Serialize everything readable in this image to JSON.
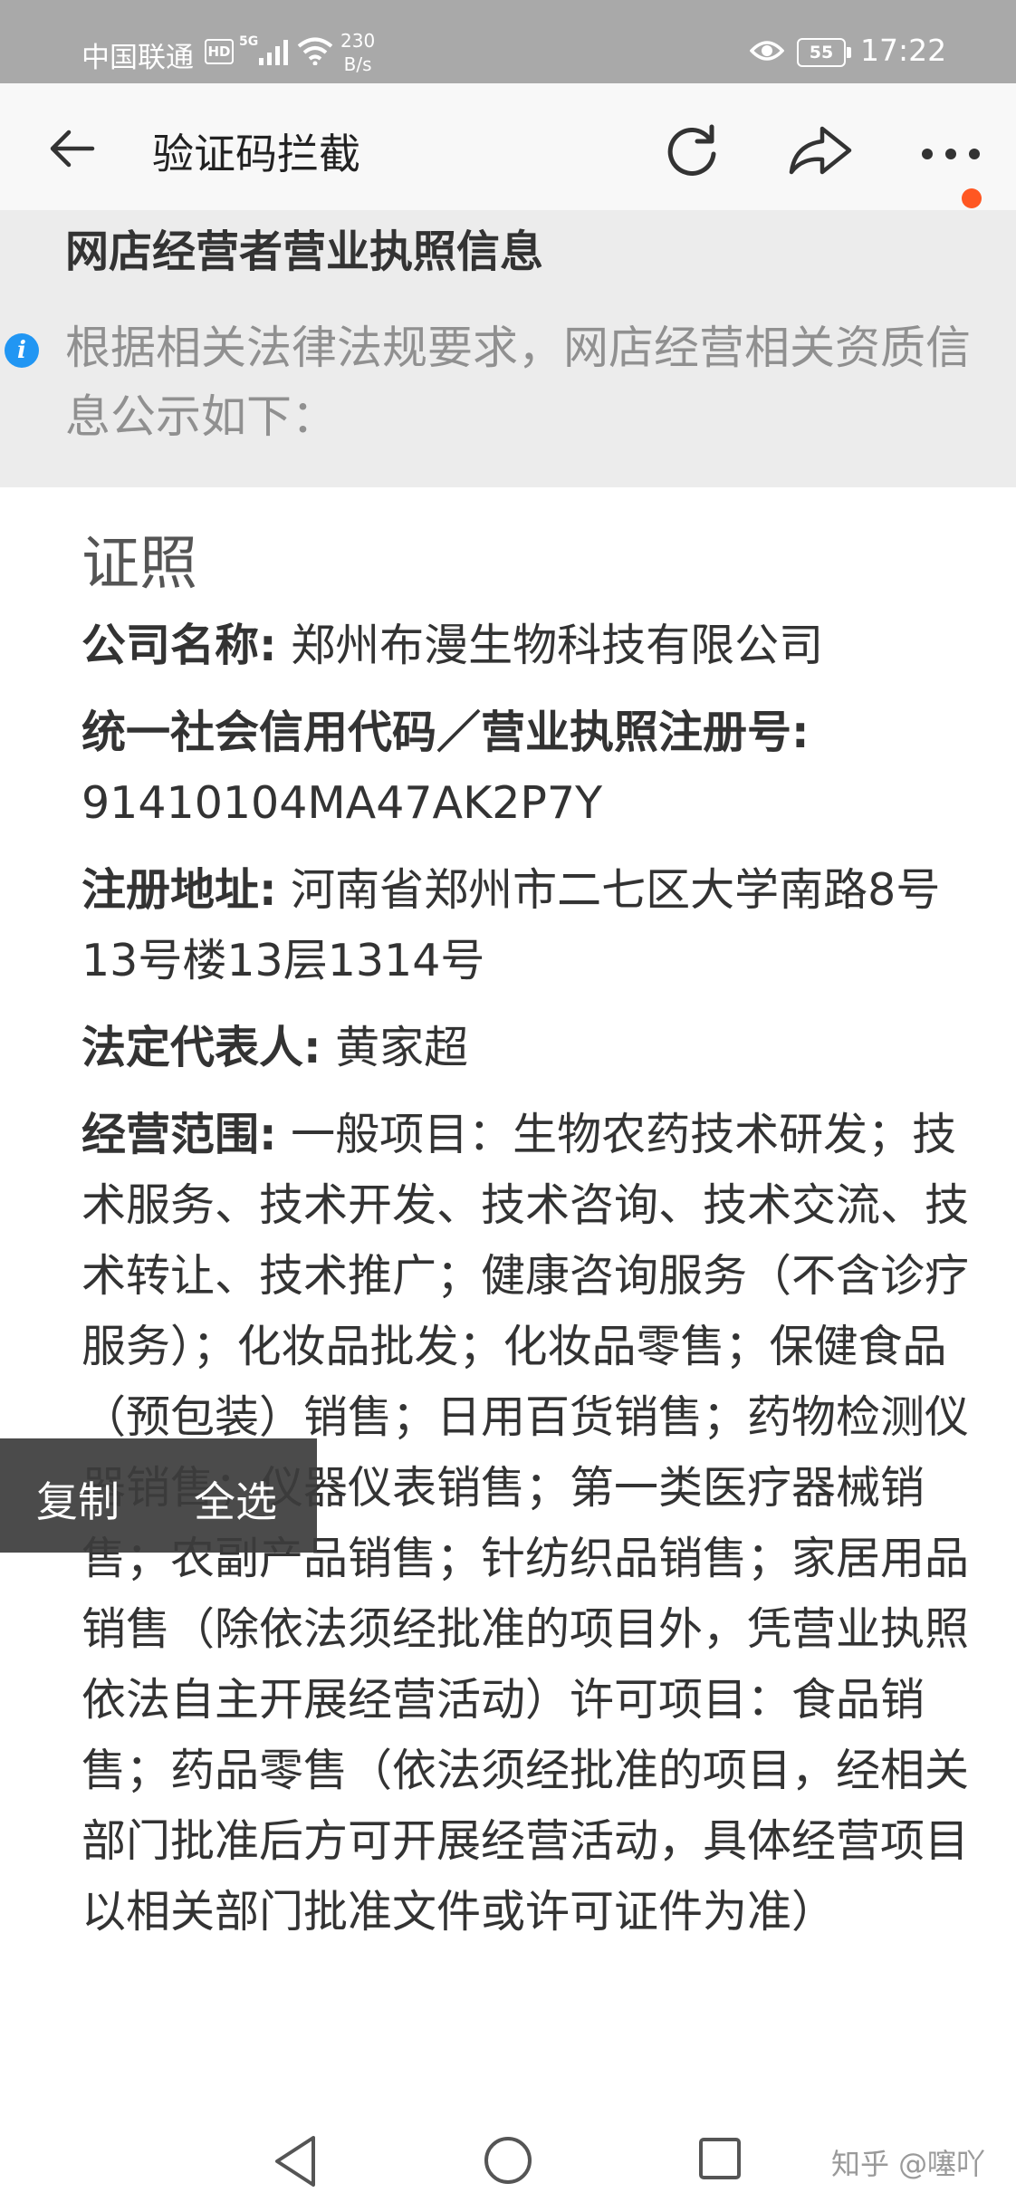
{
  "status_bar": {
    "carrier": "中国联通",
    "hd": "HD",
    "network_type": "5G",
    "speed_value": "230",
    "speed_unit": "B/s",
    "battery": "55",
    "time": "17:22"
  },
  "app_bar": {
    "title": "验证码拦截",
    "icons": [
      "back-arrow-icon",
      "refresh-icon",
      "share-icon",
      "more-icon"
    ],
    "notification_dot_color": "#ff5722"
  },
  "notice": {
    "title": "网店经营者营业执照信息",
    "text": "根据相关法律法规要求，网店经营相关资质信息公示如下："
  },
  "license": {
    "section_title": "证照",
    "fields": [
      {
        "label": "公司名称:",
        "value": " 郑州布漫生物科技有限公司"
      },
      {
        "label": "统一社会信用代码／营业执照注册号:",
        "value": " 91410104MA47AK2P7Y"
      },
      {
        "label": "注册地址:",
        "value": " 河南省郑州市二七区大学南路8号13号楼13层1314号"
      },
      {
        "label": "法定代表人:",
        "value": " 黄家超"
      },
      {
        "label": "经营范围:",
        "value": " 一般项目：生物农药技术研发；技术服务、技术开发、技术咨询、技术交流、技术转让、技术推广；健康咨询服务（不含诊疗服务）；化妆品批发；化妆品零售；保健食品（预包装）销售；日用百货销售；药物检测仪器销售；仪器仪表销售；第一类医疗器械销售；农副产品销售；针纺织品销售；家居用品销售（除依法须经批准的项目外，凭营业执照依法自主开展经营活动）许可项目：食品销售；药品零售（依法须经批准的项目，经相关部门批准后方可开展经营活动，具体经营项目以相关部门批准文件或许可证件为准）"
      }
    ]
  },
  "selection_popup": {
    "copy": "复制",
    "select_all": "全选"
  },
  "nav_bar": {
    "icons": [
      "nav-back-icon",
      "nav-home-icon",
      "nav-recent-icon"
    ],
    "watermark": "知乎 @噻吖"
  },
  "colors": {
    "status_bar_bg": "#a9a9a9",
    "app_bar_bg": "#f8f8f8",
    "notice_bg": "#ececec",
    "info_icon": "#2196f3"
  }
}
